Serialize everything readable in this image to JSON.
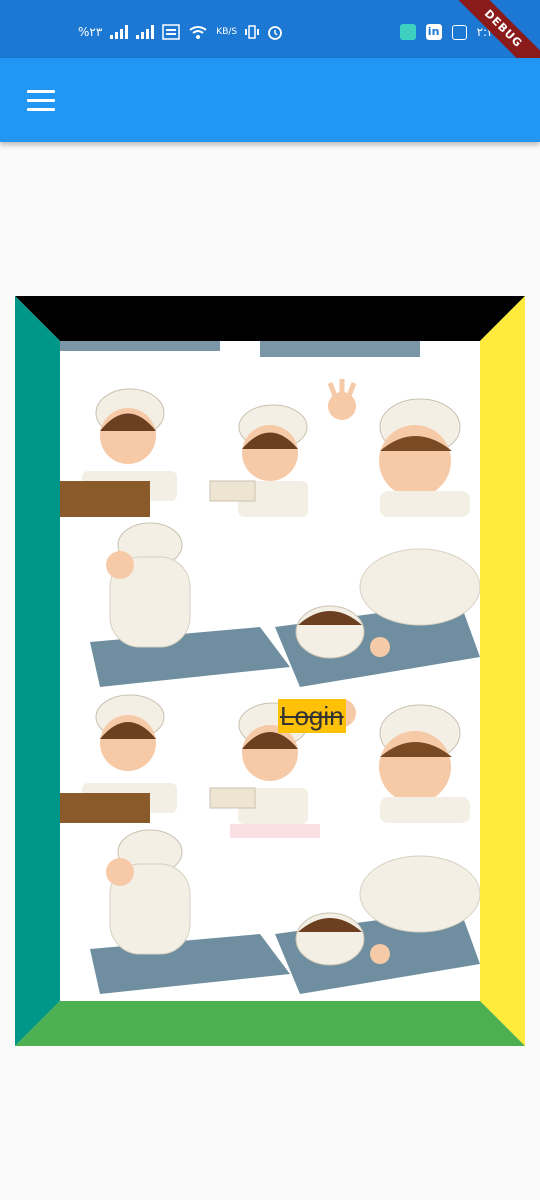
{
  "status_bar": {
    "left_text": "%٢٣",
    "data_speed": "KB/S",
    "clock": "٢:٢٩",
    "debug_banner": "DEBUG",
    "colors": {
      "background": "#1c78d2"
    }
  },
  "app_bar": {
    "menu_icon": "menu-icon",
    "colors": {
      "background": "#2196f3"
    }
  },
  "frame": {
    "colors": {
      "top": "#000000",
      "left": "#009688",
      "right": "#ffeb3b",
      "bottom": "#4caf50",
      "inner": "#ffffff"
    }
  },
  "login": {
    "label": "Login",
    "colors": {
      "background": "#ffc107"
    }
  }
}
